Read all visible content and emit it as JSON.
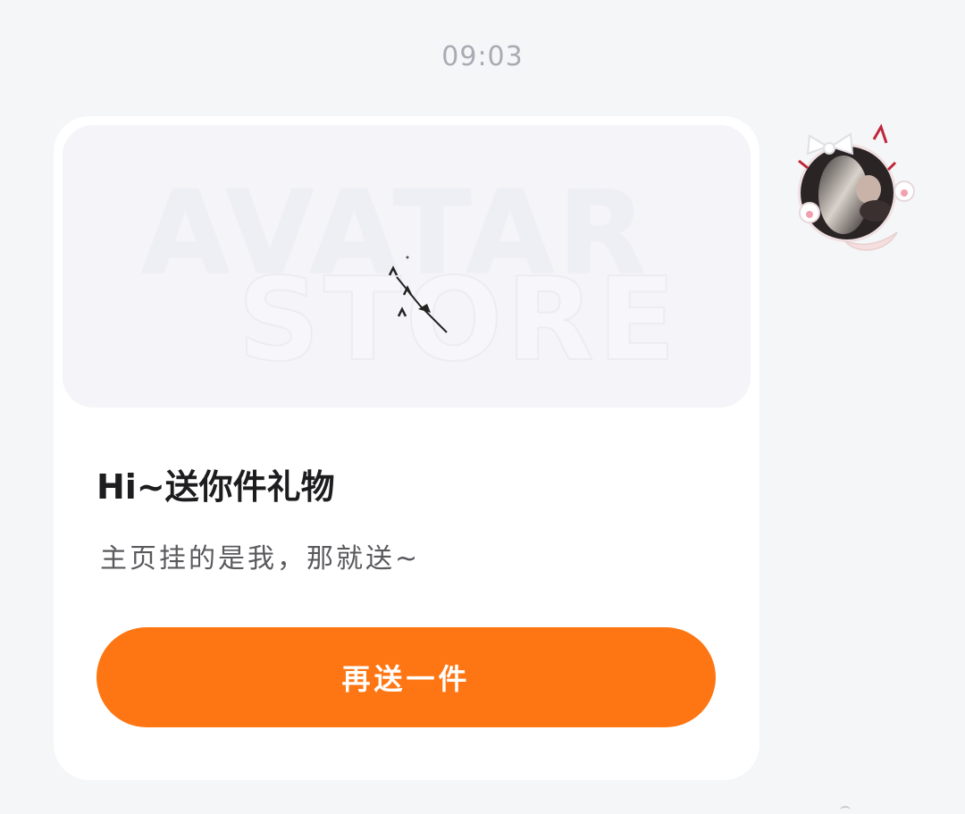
{
  "chat": {
    "timestamp": "09:03"
  },
  "gift_card": {
    "banner_watermark_line1": "AVATAR",
    "banner_watermark_line2": "STORE",
    "title": "Hi~送你件礼物",
    "subtitle": "主页挂的是我，那就送~",
    "button_label": "再送一件"
  },
  "sender": {
    "avatar": "avatar-with-bow-and-cat-ears-frame"
  },
  "colors": {
    "background": "#f5f6f8",
    "card": "#ffffff",
    "banner": "#f4f4f9",
    "accent": "#fd7613",
    "timestamp": "#a8abb2"
  }
}
